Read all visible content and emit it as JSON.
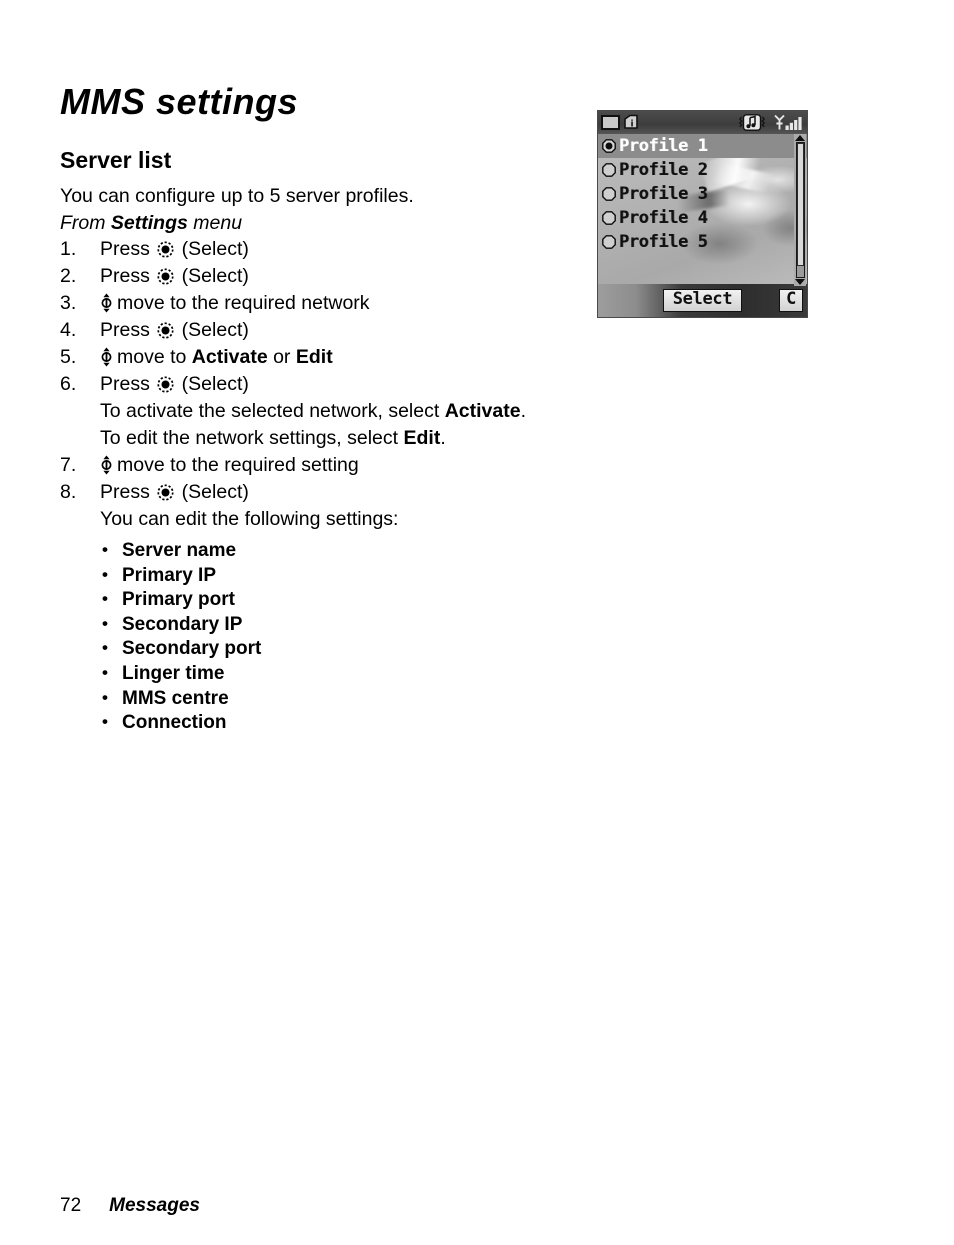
{
  "document": {
    "title": "MMS settings",
    "section_heading": "Server list",
    "intro": "You can configure up to 5 server profiles.",
    "from_menu": {
      "prefix": "From ",
      "bold": "Settings",
      "suffix": " menu"
    }
  },
  "steps": [
    {
      "num": "1.",
      "type": "press",
      "verb": "Press ",
      "icon": "select-key-icon",
      "tail": " (Select)"
    },
    {
      "num": "2.",
      "type": "press",
      "verb": "Press ",
      "icon": "select-key-icon",
      "tail": " (Select)"
    },
    {
      "num": "3.",
      "type": "move",
      "icon": "joystick-updown-icon",
      "text": "move to the required network"
    },
    {
      "num": "4.",
      "type": "press",
      "verb": "Press ",
      "icon": "select-key-icon",
      "tail": " (Select)"
    },
    {
      "num": "5.",
      "type": "move-bold",
      "icon": "joystick-updown-icon",
      "text_pre": "move to ",
      "bold1": "Activate",
      "text_mid": " or ",
      "bold2": "Edit"
    },
    {
      "num": "6.",
      "type": "press",
      "verb": "Press ",
      "icon": "select-key-icon",
      "tail": " (Select)"
    },
    {
      "num": "7.",
      "type": "move",
      "icon": "joystick-updown-icon",
      "text": "move to the required setting"
    },
    {
      "num": "8.",
      "type": "press",
      "verb": "Press ",
      "icon": "select-key-icon",
      "tail": " (Select)"
    }
  ],
  "notes": {
    "activate_pre": "To activate the selected network, select ",
    "activate_bold": "Activate",
    "activate_post": ".",
    "edit_pre": "To edit the network settings, select ",
    "edit_bold": "Edit",
    "edit_post": ".",
    "edit_intro": "You can edit the following settings:"
  },
  "settings_list": [
    "Server name",
    "Primary IP",
    "Primary port",
    "Secondary IP",
    "Secondary port",
    "Linger time",
    "MMS centre",
    "Connection"
  ],
  "phone_screenshot": {
    "status_bar": {
      "icons": [
        "battery-icon",
        "info-icon",
        "vibrate-music-icon",
        "signal-strength-icon"
      ]
    },
    "profiles": [
      {
        "label": "Profile 1",
        "selected": true,
        "radio": "radio-filled"
      },
      {
        "label": "Profile 2",
        "selected": false,
        "radio": "radio-empty"
      },
      {
        "label": "Profile 3",
        "selected": false,
        "radio": "radio-empty"
      },
      {
        "label": "Profile 4",
        "selected": false,
        "radio": "radio-empty"
      },
      {
        "label": "Profile 5",
        "selected": false,
        "radio": "radio-empty"
      }
    ],
    "softkeys": {
      "center": "Select",
      "right": "C"
    }
  },
  "footer": {
    "page_number": "72",
    "section": "Messages"
  },
  "colors": {
    "text": "#000000",
    "page_background": "#ffffff",
    "phone_screen_background": "#b4b4b4",
    "phone_status_bar": "#3d3d3d",
    "phone_selection": "#8c8c8c",
    "phone_selection_text": "#ffffff",
    "phone_softbar": "#2e2e2e"
  }
}
